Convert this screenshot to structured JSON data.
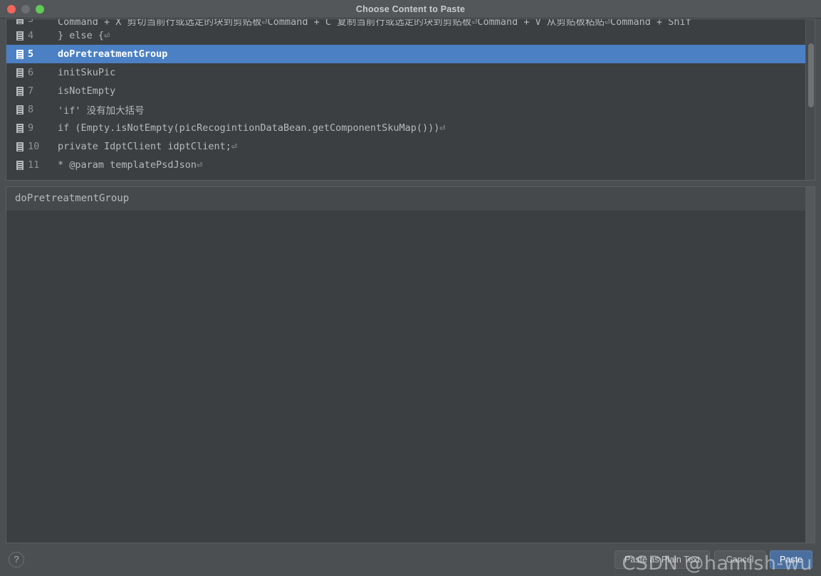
{
  "window": {
    "title": "Choose Content to Paste",
    "traffic_lights": [
      {
        "name": "close",
        "color": "#f1665c"
      },
      {
        "name": "minimize",
        "color": "#6b6f71"
      },
      {
        "name": "zoom",
        "color": "#5ecc55"
      }
    ]
  },
  "list": {
    "selection_color": "#4b80c4",
    "rows": [
      {
        "line": "3",
        "text": "Command + X 剪切当前行或选定的块到剪贴板⏎Command + C 复制当前行或选定的块到剪贴板⏎Command + V 从剪贴板粘贴⏎Command + Shif",
        "selected": false,
        "clipped": true
      },
      {
        "line": "4",
        "text": "            } else {⏎",
        "selected": false,
        "clipped": false
      },
      {
        "line": "5",
        "text": "doPretreatmentGroup",
        "selected": true,
        "clipped": false
      },
      {
        "line": "6",
        "text": "initSkuPic",
        "selected": false,
        "clipped": false
      },
      {
        "line": "7",
        "text": "isNotEmpty",
        "selected": false,
        "clipped": false
      },
      {
        "line": "8",
        "text": "'if' 没有加大括号",
        "selected": false,
        "clipped": false
      },
      {
        "line": "9",
        "text": "        if (Empty.isNotEmpty(picRecogintionDataBean.getComponentSkuMap()))⏎",
        "selected": false,
        "clipped": false
      },
      {
        "line": "10",
        "text": "  private IdptClient idptClient;⏎",
        "selected": false,
        "clipped": false
      },
      {
        "line": "11",
        "text": "   * @param templatePsdJson⏎",
        "selected": false,
        "clipped": false
      }
    ]
  },
  "preview": {
    "text": "doPretreatmentGroup"
  },
  "bottom": {
    "help_label": "?",
    "paste_plain_label": "Paste as Plain Text",
    "cancel_label": "Cancel",
    "paste_label": "Paste"
  },
  "watermark": {
    "text": "CSDN @hamish-wu"
  }
}
